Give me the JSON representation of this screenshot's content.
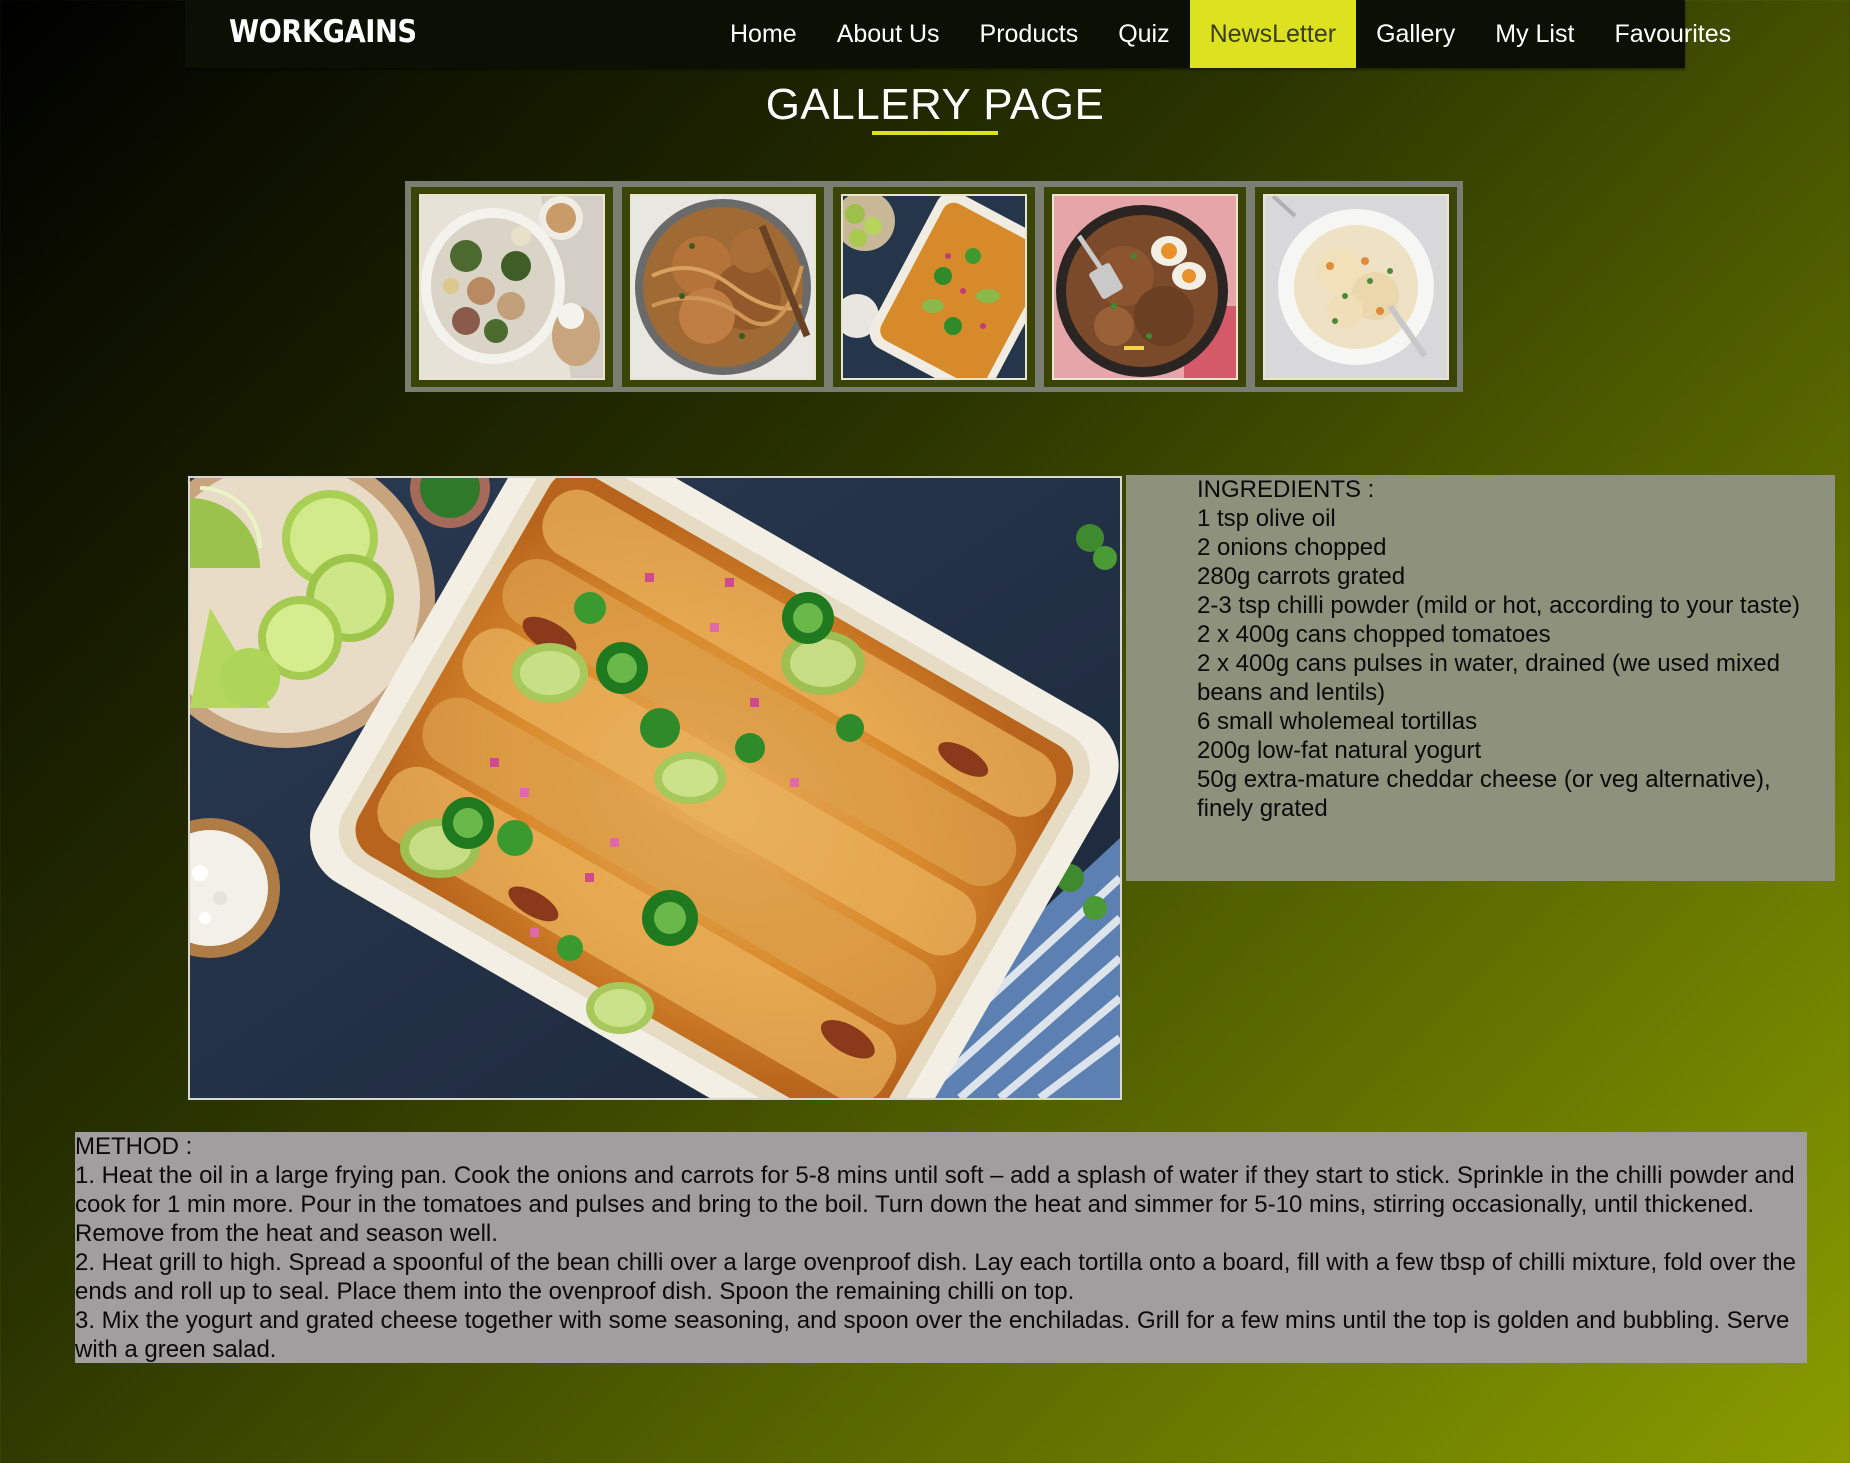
{
  "brand": {
    "logo_text": "WORKGAINS"
  },
  "nav": {
    "items": [
      {
        "label": "Home"
      },
      {
        "label": "About Us"
      },
      {
        "label": "Products"
      },
      {
        "label": "Quiz"
      },
      {
        "label": "NewsLetter",
        "active": true
      },
      {
        "label": "Gallery"
      },
      {
        "label": "My List"
      },
      {
        "label": "Favourites"
      }
    ]
  },
  "page": {
    "title": "GALLERY PAGE"
  },
  "gallery": {
    "thumbnails": [
      {
        "subject": "chickpea-ham-salad-bowl"
      },
      {
        "subject": "noodle-stir-fry-pan"
      },
      {
        "subject": "enchilada-baking-dish"
      },
      {
        "subject": "fried-rice-with-eggs-wok"
      },
      {
        "subject": "creamy-pasta-plate"
      }
    ],
    "selected": {
      "subject": "enchilada-baking-dish"
    }
  },
  "ingredients": {
    "heading": "INGREDIENTS :",
    "items": [
      "1 tsp olive oil",
      "2 onions chopped",
      "280g carrots grated",
      "2-3 tsp chilli powder (mild or hot, according to your taste)",
      "2 x 400g cans chopped tomatoes",
      "2 x 400g cans pulses in water, drained (we used mixed beans and lentils)",
      "6 small wholemeal tortillas",
      "200g low-fat natural yogurt",
      "50g extra-mature cheddar cheese (or veg alternative), finely grated"
    ]
  },
  "method": {
    "heading": "METHOD :",
    "steps": [
      "1. Heat the oil in a large frying pan. Cook the onions and carrots for 5-8 mins until soft – add a splash of water if they start to stick. Sprinkle in the chilli powder and cook for 1 min more. Pour in the tomatoes and pulses and bring to the boil. Turn down the heat and simmer for 5-10 mins, stirring occasionally, until thickened. Remove from the heat and season well.",
      "2. Heat grill to high. Spread a spoonful of the bean chilli over a large ovenproof dish. Lay each tortilla onto a board, fill with a few tbsp of chilli mixture, fold over the ends and roll up to seal. Place them into the ovenproof dish. Spoon the remaining chilli on top.",
      "3. Mix the yogurt and grated cheese together with some seasoning, and spoon over the enchiladas. Grill for a few mins until the top is golden and bubbling. Serve with a green salad."
    ]
  },
  "colors": {
    "accent": "#dde220",
    "nav_bg": "#0c0f04",
    "ingredients_bg": "#8e917c",
    "method_bg": "#a09e9e"
  }
}
